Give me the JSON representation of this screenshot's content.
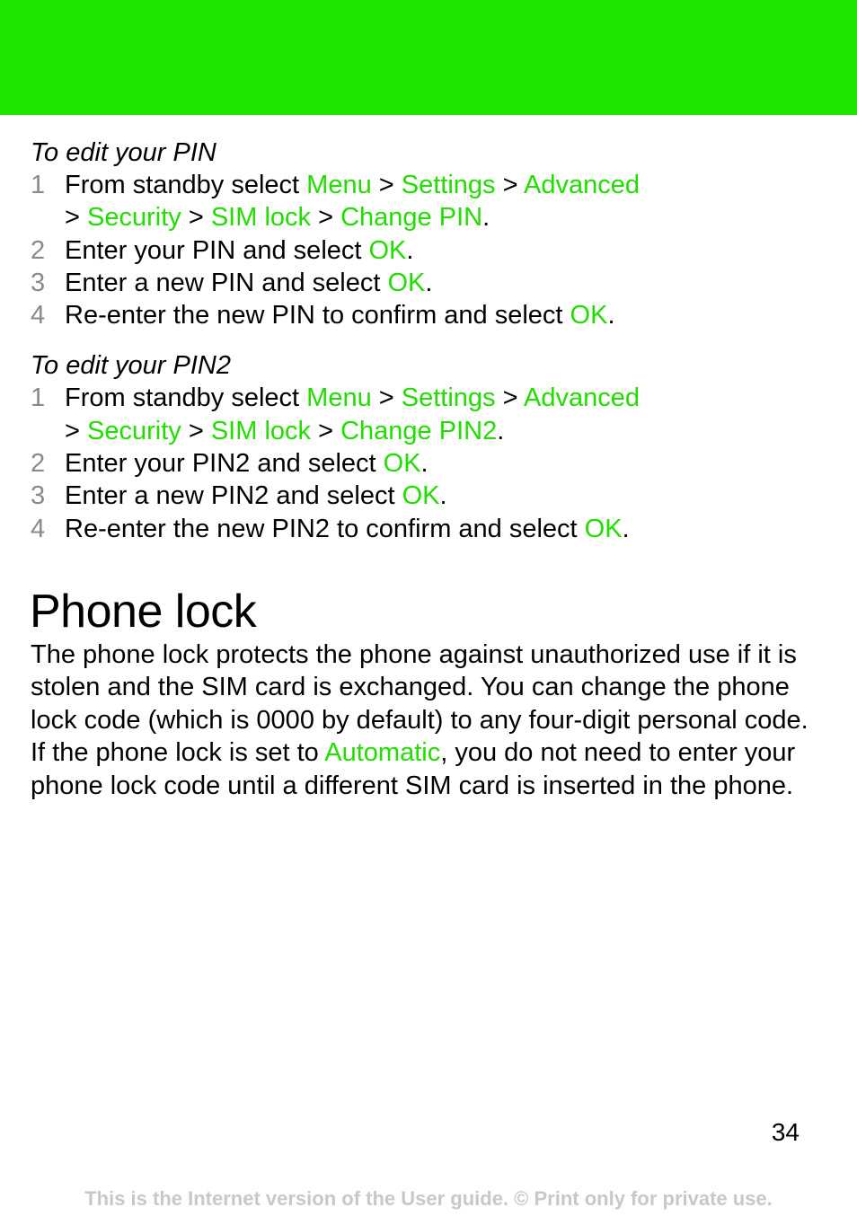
{
  "colors": {
    "header_band": "#1fe300",
    "accent_text": "#22dd00",
    "step_number": "#8a8a8a",
    "footer": "#c8c8c8"
  },
  "pin_section": {
    "heading": "To edit your PIN",
    "steps": [
      {
        "num": "1",
        "pre": "From standby select ",
        "path": [
          "Menu",
          "Settings",
          "Advanced",
          "Security",
          "SIM lock",
          "Change PIN"
        ],
        "sep": " > ",
        "post": "."
      },
      {
        "num": "2",
        "pre": "Enter your PIN and select ",
        "action": "OK",
        "post": "."
      },
      {
        "num": "3",
        "pre": "Enter a new PIN and select ",
        "action": "OK",
        "post": "."
      },
      {
        "num": "4",
        "pre": "Re-enter the new PIN to confirm and select ",
        "action": "OK",
        "post": "."
      }
    ]
  },
  "pin2_section": {
    "heading": "To edit your PIN2",
    "steps": [
      {
        "num": "1",
        "pre": "From standby select ",
        "path": [
          "Menu",
          "Settings",
          "Advanced",
          "Security",
          "SIM lock",
          "Change PIN2"
        ],
        "sep": " > ",
        "post": "."
      },
      {
        "num": "2",
        "pre": "Enter your PIN2 and select ",
        "action": "OK",
        "post": "."
      },
      {
        "num": "3",
        "pre": "Enter a new PIN2 and select ",
        "action": "OK",
        "post": "."
      },
      {
        "num": "4",
        "pre": "Re-enter the new PIN2 to confirm and select ",
        "action": "OK",
        "post": "."
      }
    ]
  },
  "phone_lock": {
    "title": "Phone lock",
    "paragraph1": "The phone lock protects the phone against unauthorized use if it is stolen and the SIM card is exchanged. You can change the phone lock code (which is 0000 by default) to any four-digit personal code.",
    "paragraph2_pre": "If the phone lock is set to ",
    "paragraph2_highlight": "Automatic",
    "paragraph2_post": ", you do not need to enter your phone lock code until a different SIM card is inserted in the phone."
  },
  "page_number": "34",
  "footer": "This is the Internet version of the User guide. © Print only for private use."
}
